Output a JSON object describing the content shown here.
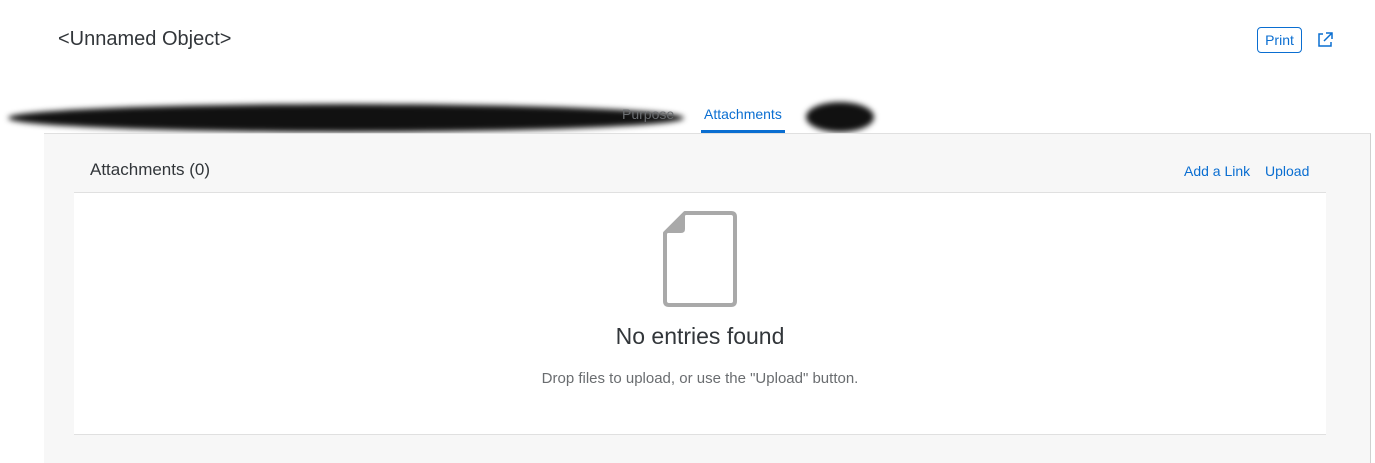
{
  "header": {
    "title": "<Unnamed Object>",
    "print_label": "Print",
    "share_icon": "share-icon"
  },
  "tabs": {
    "purpose_label": "Purpose",
    "attachments_label": "Attachments",
    "active": "Attachments"
  },
  "attachments": {
    "title": "Attachments (0)",
    "add_link_label": "Add a Link",
    "upload_label": "Upload",
    "empty_icon": "document-icon",
    "empty_title": "No entries found",
    "empty_description": "Drop files to upload, or use the \"Upload\" button."
  },
  "colors": {
    "accent": "#0a6ed1",
    "text": "#32363a",
    "muted": "#6a6d70",
    "icon_gray": "#a9a9a9",
    "content_bg": "#f7f7f7"
  }
}
